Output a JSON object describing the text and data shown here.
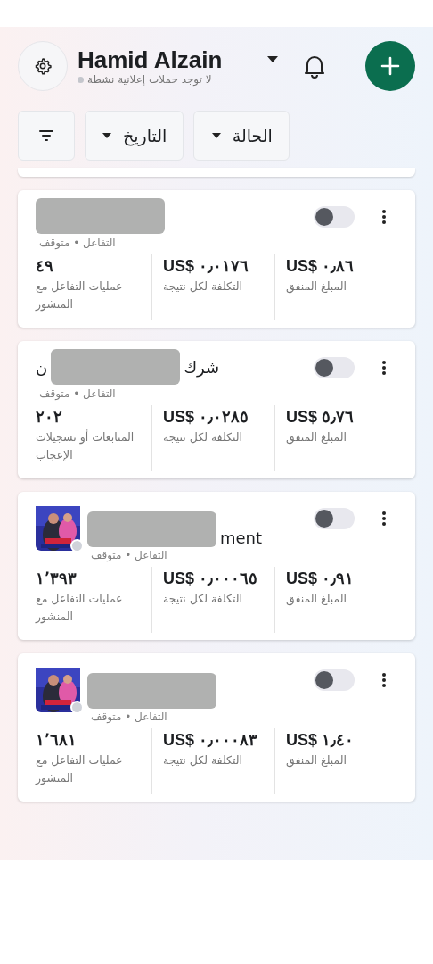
{
  "header": {
    "account_name": "Hamid Alzain",
    "status": "لا توجد حملات إعلانية نشطة"
  },
  "filters": [
    {
      "kind": "dropdown",
      "label": "الحالة"
    },
    {
      "kind": "dropdown",
      "label": "التاريخ"
    },
    {
      "kind": "icon"
    }
  ],
  "campaigns": [
    {
      "thumbnail": false,
      "redacted": true,
      "subtitle": "التفاعل • متوقف",
      "on": false,
      "metrics": [
        {
          "value": "US$ ٠٫٨٦",
          "label": "المبلغ المنفق"
        },
        {
          "value": "US$ ٠٫٠١٧٦",
          "label": "التكلفة لكل نتيجة"
        },
        {
          "value": "٤٩",
          "label": "عمليات التفاعل مع المنشور"
        }
      ]
    },
    {
      "thumbnail": false,
      "redacted": true,
      "title_after": "شرك",
      "title_before": "ن",
      "subtitle": "التفاعل • متوقف",
      "on": false,
      "metrics": [
        {
          "value": "US$ ٥٫٧٦",
          "label": "المبلغ المنفق"
        },
        {
          "value": "US$ ٠٫٠٢٨٥",
          "label": "التكلفة لكل نتيجة"
        },
        {
          "value": "٢٠٢",
          "label": "المتابعات أو تسجيلات الإعجاب"
        }
      ]
    },
    {
      "thumbnail": true,
      "redacted": true,
      "title_after": "ment",
      "subtitle": "التفاعل • متوقف",
      "on": false,
      "metrics": [
        {
          "value": "US$ ٠٫٩١",
          "label": "المبلغ المنفق"
        },
        {
          "value": "US$ ٠٫٠٠٠٦٥",
          "label": "التكلفة لكل نتيجة"
        },
        {
          "value": "١٬٣٩٣",
          "label": "عمليات التفاعل مع المنشور"
        }
      ]
    },
    {
      "thumbnail": true,
      "redacted": true,
      "subtitle": "التفاعل • متوقف",
      "on": false,
      "metrics": [
        {
          "value": "US$ ١٫٤٠",
          "label": "المبلغ المنفق"
        },
        {
          "value": "US$ ٠٫٠٠٠٨٣",
          "label": "التكلفة لكل نتيجة"
        },
        {
          "value": "١٬٦٨١",
          "label": "عمليات التفاعل مع المنشور"
        }
      ]
    }
  ]
}
